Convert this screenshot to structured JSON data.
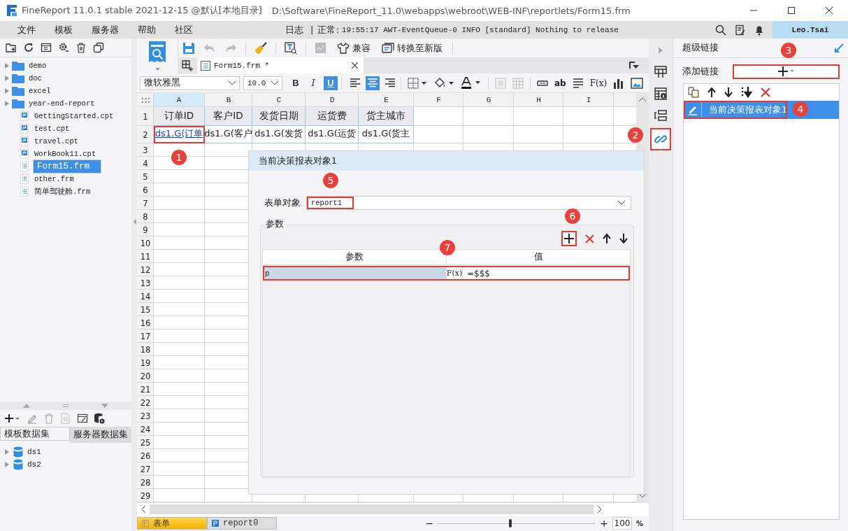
{
  "window": {
    "title": "FineReport 11.0.1 stable 2021-12-15 @默认[本地目录]",
    "path": "D:\\Software\\FineReport_11.0\\webapps\\webroot\\WEB-INF\\reportlets/Form15.frm"
  },
  "menu": [
    "文件",
    "模板",
    "服务器",
    "帮助",
    "社区"
  ],
  "status": {
    "log_label": "日志",
    "separator": "|",
    "state": "正常:",
    "message": "19:55:17 AWT-EventQueue-0 INFO [standard] Nothing to release"
  },
  "user": "Leo.Tsai",
  "file_tree": [
    {
      "label": "demo",
      "kind": "folder",
      "expanded": false,
      "selected": false
    },
    {
      "label": "doc",
      "kind": "folder",
      "expanded": false,
      "selected": false
    },
    {
      "label": "excel",
      "kind": "folder",
      "expanded": false,
      "selected": false
    },
    {
      "label": "year-end-report",
      "kind": "folder",
      "expanded": false,
      "selected": false
    },
    {
      "label": "GettingStarted.cpt",
      "kind": "report",
      "selected": false
    },
    {
      "label": "test.cpt",
      "kind": "report",
      "selected": false
    },
    {
      "label": "travel.cpt",
      "kind": "report",
      "selected": false
    },
    {
      "label": "WorkBook11.cpt",
      "kind": "report",
      "selected": false
    },
    {
      "label": "Form15.frm",
      "kind": "form",
      "selected": true
    },
    {
      "label": "other.frm",
      "kind": "form",
      "selected": false
    },
    {
      "label": "简单驾驶舱.frm",
      "kind": "form",
      "selected": false
    }
  ],
  "dataset_tabs": [
    {
      "label": "模板数据集",
      "selected": true
    },
    {
      "label": "服务器数据集",
      "selected": false
    }
  ],
  "datasets": [
    {
      "label": "ds1",
      "expanded": false
    },
    {
      "label": "ds2",
      "expanded": false
    }
  ],
  "toolbar": {
    "compat": "兼容",
    "convert": "转换至新版"
  },
  "doc_tab": {
    "label": "Form15.frm *"
  },
  "format": {
    "font": "微软雅黑",
    "size": "10.0",
    "styles": [
      {
        "label": "B",
        "selected": false
      },
      {
        "label": "I",
        "selected": false
      },
      {
        "label": "U",
        "selected": true
      }
    ],
    "alignment": [
      {
        "kind": "left",
        "selected": false
      },
      {
        "kind": "center",
        "selected": true
      },
      {
        "kind": "right",
        "selected": false
      }
    ],
    "text_tool": "ab",
    "formula_tool": "F(x)"
  },
  "sheet": {
    "columns": [
      {
        "label": "A",
        "selected": true
      },
      {
        "label": "B",
        "selected": false
      },
      {
        "label": "C",
        "selected": false
      },
      {
        "label": "D",
        "selected": false
      },
      {
        "label": "E",
        "selected": false
      },
      {
        "label": "F",
        "selected": false
      },
      {
        "label": "G",
        "selected": false
      },
      {
        "label": "H",
        "selected": false
      },
      {
        "label": "I",
        "selected": false
      }
    ],
    "row_numbers": [
      "1",
      "2",
      "3",
      "4",
      "5",
      "6",
      "7",
      "8",
      "9",
      "10",
      "11",
      "12",
      "13",
      "14",
      "15",
      "16",
      "17",
      "18",
      "19",
      "20",
      "21",
      "22",
      "23",
      "24",
      "25",
      "26",
      "27",
      "28",
      "29"
    ],
    "rows": [
      [
        {
          "text": "订单ID",
          "link": false
        },
        {
          "text": "客户ID",
          "link": false
        },
        {
          "text": "发货日期",
          "link": false
        },
        {
          "text": "运货费",
          "link": false
        },
        {
          "text": "货主城市",
          "link": false
        }
      ],
      [
        {
          "text": "ds1.G(订单",
          "link": true
        },
        {
          "text": "ds1.G(客户",
          "link": false
        },
        {
          "text": "ds1.G(发货",
          "link": false
        },
        {
          "text": "ds1.G(运货",
          "link": false
        },
        {
          "text": "ds1.G(货主",
          "link": false
        }
      ]
    ]
  },
  "sheet_tabs": [
    {
      "label": "表单",
      "selected": true
    },
    {
      "label": "report0",
      "selected": false
    }
  ],
  "zoom": {
    "minus": "−",
    "plus": "+",
    "value": "100",
    "unit": "%",
    "level": 0.46
  },
  "dialog": {
    "title": "当前决策报表对象1",
    "object_label": "表单对象",
    "object_value": "report1",
    "params_label": "参数",
    "columns": [
      "参数",
      "值"
    ],
    "rows": [
      {
        "name": "p",
        "fx": "F(x)",
        "value": "=$$$"
      }
    ]
  },
  "side_icons": [
    {
      "kind": "collapse",
      "selected": false
    },
    {
      "kind": "layout",
      "selected": false
    },
    {
      "kind": "info",
      "selected": false
    },
    {
      "kind": "widget",
      "selected": false
    },
    {
      "kind": "link",
      "selected": true
    }
  ],
  "hyperlink_panel": {
    "title": "超级链接",
    "add_label": "添加链接",
    "items": [
      {
        "label": "当前决策报表对象1",
        "selected": true
      }
    ]
  },
  "callouts": [
    "1",
    "2",
    "3",
    "4",
    "5",
    "6",
    "7"
  ]
}
